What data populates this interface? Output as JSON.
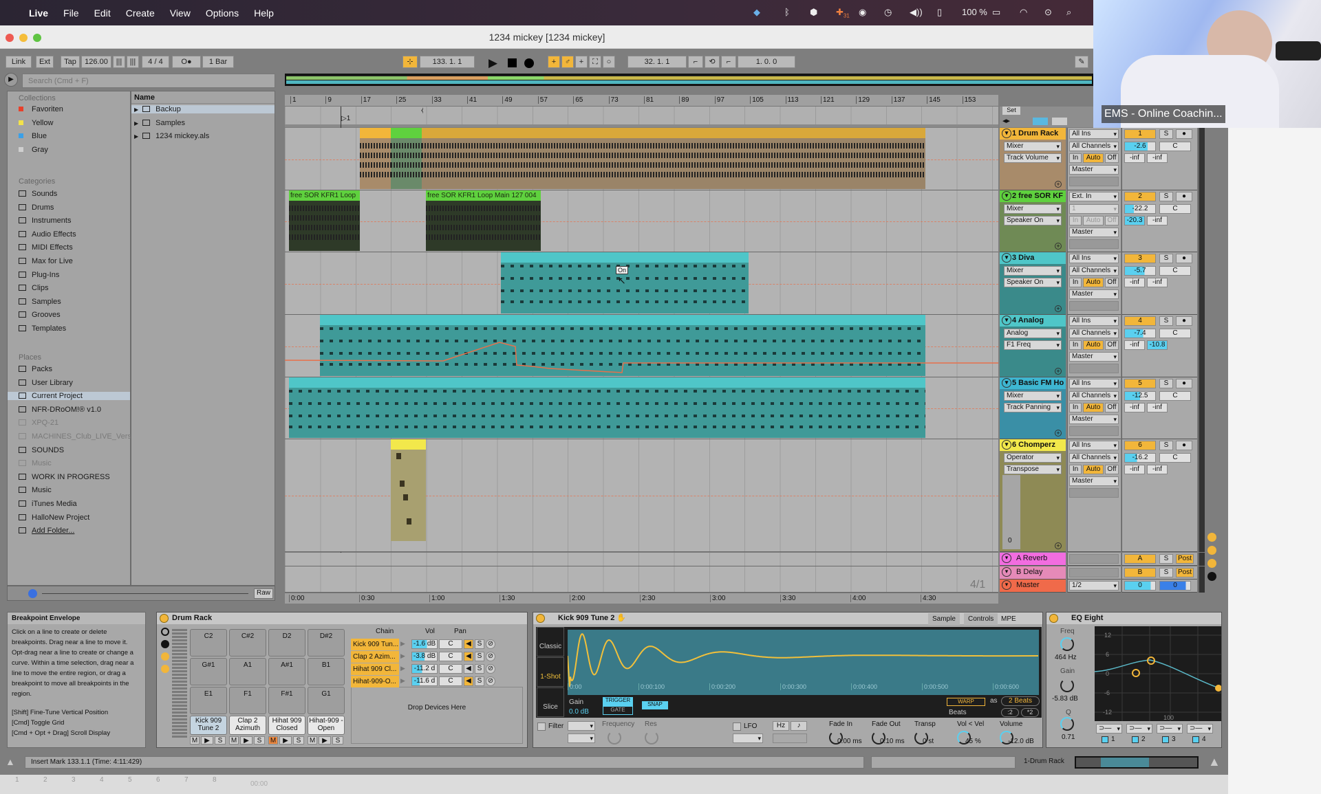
{
  "menubar": {
    "app": "Live",
    "items": [
      "File",
      "Edit",
      "Create",
      "View",
      "Options",
      "Help"
    ],
    "battery": "100 %",
    "calendar_badge": "31"
  },
  "window": {
    "title": "1234 mickey [1234 mickey]"
  },
  "webcam": {
    "label": "EMS - Online Coachin..."
  },
  "control_bar": {
    "link": "Link",
    "ext": "Ext",
    "tap": "Tap",
    "tempo": "126.00",
    "signature": "4 / 4",
    "metronome": "O●",
    "quantize": "1 Bar",
    "position": "133.  1.  1",
    "loop_start": "32.  1.  1",
    "loop_length": "1.  0.  0"
  },
  "browser": {
    "search_placeholder": "Search (Cmd + F)",
    "collections_header": "Collections",
    "collections": [
      {
        "label": "Favoriten",
        "color": "#e8402a"
      },
      {
        "label": "Yellow",
        "color": "#f2e24a"
      },
      {
        "label": "Blue",
        "color": "#3aa0e8"
      },
      {
        "label": "Gray",
        "color": "#cfcfcf"
      }
    ],
    "categories_header": "Categories",
    "categories": [
      "Sounds",
      "Drums",
      "Instruments",
      "Audio Effects",
      "MIDI Effects",
      "Max for Live",
      "Plug-Ins",
      "Clips",
      "Samples",
      "Grooves",
      "Templates"
    ],
    "places_header": "Places",
    "places": [
      {
        "label": "Packs"
      },
      {
        "label": "User Library"
      },
      {
        "label": "Current Project",
        "selected": true
      },
      {
        "label": "NFR-DRoOM!® v1.0"
      },
      {
        "label": "XPQ-21",
        "dim": true
      },
      {
        "label": "MACHINES_Club_LIVE_Versio",
        "dim": true
      },
      {
        "label": "SOUNDS"
      },
      {
        "label": "Music",
        "dim": true
      },
      {
        "label": "WORK IN PROGRESS"
      },
      {
        "label": "Music"
      },
      {
        "label": "iTunes Media"
      },
      {
        "label": "HalloNew Project"
      },
      {
        "label": "Add Folder..."
      }
    ],
    "name_header": "Name",
    "files": [
      {
        "label": "Backup",
        "selected": true
      },
      {
        "label": "Samples"
      },
      {
        "label": "1234 mickey.als"
      }
    ],
    "preview_raw": "Raw"
  },
  "arrangement": {
    "bar_ticks": [
      "1",
      "9",
      "17",
      "25",
      "33",
      "41",
      "49",
      "57",
      "65",
      "73",
      "81",
      "89",
      "97",
      "105",
      "113",
      "121",
      "129",
      "137",
      "145",
      "153"
    ],
    "time_ticks": [
      "0:00",
      "0:30",
      "1:00",
      "1:30",
      "2:00",
      "2:30",
      "3:00",
      "3:30",
      "4:00",
      "4:30"
    ],
    "locator": "1",
    "set_label": "Set",
    "zoom": "4/1",
    "tooltip": "On"
  },
  "tracks": [
    {
      "number": "1",
      "name": "1 Drum Rack",
      "color": "#f2b63a",
      "body": "#a88b6a",
      "device": "Mixer",
      "param": "Track Volume",
      "input": "All Ins",
      "channel": "All Channels",
      "output": "Master",
      "volume": "-2.6",
      "volume_level": 0.75,
      "pan": "C",
      "send_a": "-inf",
      "send_b": "-inf",
      "clips": [
        {
          "start": 17,
          "end": 24,
          "color": "#f2b63a",
          "body": "#a88b6a"
        },
        {
          "start": 24,
          "end": 31,
          "color": "#5fd13e",
          "body": "#6a8a6a"
        },
        {
          "start": 31,
          "end": 145,
          "color": "#d9a83a",
          "body": "#9a8468"
        }
      ]
    },
    {
      "number": "2",
      "name": "2 free SOR KF",
      "color": "#5fd13e",
      "body": "#6f8a55",
      "device": "Mixer",
      "param": "Speaker On",
      "input": "Ext. In",
      "channel": "1",
      "output": "Master",
      "volume": "-22.2",
      "volume_level": 0.3,
      "pan": "C",
      "send_a": "-20.3",
      "send_b": "-inf",
      "clips": [
        {
          "start": 1,
          "end": 17,
          "color": "#5fd13e",
          "body": "#2e3a28",
          "label": "free SOR KFR1 Loop"
        },
        {
          "start": 32,
          "end": 58,
          "color": "#5fd13e",
          "body": "#2e3a28",
          "label": "free SOR KFR1 Loop Main 127 004"
        }
      ]
    },
    {
      "number": "3",
      "name": "3 Diva",
      "color": "#4fc6c8",
      "body": "#3a8a8a",
      "device": "Mixer",
      "param": "Speaker On",
      "input": "All Ins",
      "channel": "All Channels",
      "output": "Master",
      "volume": "-5.7",
      "volume_level": 0.65,
      "pan": "C",
      "send_a": "-inf",
      "send_b": "-inf",
      "clips": [
        {
          "start": 49,
          "end": 105,
          "color": "#4fc6c8",
          "body": "#3f9a98"
        }
      ]
    },
    {
      "number": "4",
      "name": "4 Analog",
      "color": "#4fc6c8",
      "body": "#3a8a8a",
      "device": "Analog",
      "param": "F1 Freq",
      "input": "All Ins",
      "channel": "All Channels",
      "output": "Master",
      "volume": "-7.4",
      "volume_level": 0.6,
      "pan": "C",
      "send_a": "-inf",
      "send_b": "-10.8",
      "clips": [
        {
          "start": 8,
          "end": 145,
          "color": "#4fc6c8",
          "body": "#3f9a98"
        }
      ]
    },
    {
      "number": "5",
      "name": "5 Basic FM Ho",
      "color": "#3eb6d1",
      "body": "#3a8fa6",
      "device": "Mixer",
      "param": "Track Panning",
      "input": "All Ins",
      "channel": "All Channels",
      "output": "Master",
      "volume": "-12.5",
      "volume_level": 0.5,
      "pan": "C",
      "send_a": "-inf",
      "send_b": "-inf",
      "clips": [
        {
          "start": 1,
          "end": 145,
          "color": "#4fc6c8",
          "body": "#3f9a98"
        }
      ]
    },
    {
      "number": "6",
      "name": "6 Chomperz",
      "color": "#f2e84b",
      "body": "#8e8a55",
      "device": "Operator",
      "param": "Transpose",
      "input": "All Ins",
      "channel": "All Channels",
      "output": "Master",
      "volume": "-16.2",
      "volume_level": 0.4,
      "pan": "C",
      "send_a": "-inf",
      "send_b": "-inf",
      "lane_value": "0",
      "clips": [
        {
          "start": 24,
          "end": 32,
          "color": "#f2e84b",
          "body": "#a8a070"
        }
      ]
    }
  ],
  "returns": [
    {
      "name": "A Reverb",
      "color": "#f26de0",
      "letter": "A",
      "solo": "S",
      "post": "Post"
    },
    {
      "name": "B Delay",
      "color": "#e58ab8",
      "letter": "B",
      "solo": "S",
      "post": "Post"
    }
  ],
  "master": {
    "name": "Master",
    "color": "#f06a4a",
    "output": "1/2",
    "volume": "0",
    "pan": "0"
  },
  "mixer_labels": {
    "solo": "S",
    "in": "In",
    "auto": "Auto",
    "off": "Off"
  },
  "info": {
    "title": "Breakpoint Envelope",
    "body": "Click on a line to create or delete breakpoints. Drag near a line to move it. Opt-drag near a line to create or change a curve. Within a time selection, drag near a line to move the entire region, or drag a breakpoint to move all breakpoints in the region.",
    "shortcuts": [
      "[Shift] Fine-Tune Vertical Position",
      "[Cmd] Toggle Grid",
      "[Cmd + Opt + Drag] Scroll Display"
    ]
  },
  "drum_rack": {
    "title": "Drum Rack",
    "pads": [
      "C2",
      "C#2",
      "D2",
      "D#2",
      "G#1",
      "A1",
      "A#1",
      "B1",
      "E1",
      "F1",
      "F#1",
      "G1"
    ],
    "named_pads": [
      {
        "label": "Kick 909 Tune 2",
        "muted": false
      },
      {
        "label": "Clap 2 Azimuth",
        "muted": false
      },
      {
        "label": "Hihat 909 Closed",
        "muted": true
      },
      {
        "label": "Hihat-909 -Open",
        "muted": false
      }
    ],
    "pad_buttons": [
      "M",
      "S"
    ],
    "chain_header": "Chain",
    "vol_header": "Vol",
    "pan_header": "Pan",
    "chains": [
      {
        "name": "Kick 909 Tun...",
        "vol": "-1.6 dB",
        "pan": "C"
      },
      {
        "name": "Clap 2 Azim...",
        "vol": "-3.8 dB",
        "pan": "C"
      },
      {
        "name": "Hihat 909 Cl...",
        "vol": "-11.2 d",
        "pan": "C"
      },
      {
        "name": "Hihat-909-O...",
        "vol": "-11.6 d",
        "pan": "C"
      }
    ],
    "drop": "Drop Devices Here"
  },
  "simpler": {
    "title": "Kick 909 Tune 2",
    "tabs": [
      "Sample",
      "Controls",
      "MPE"
    ],
    "modes": [
      "Classic",
      "1-Shot",
      "Slice"
    ],
    "active_mode": "1-Shot",
    "time_labels": [
      "0:00",
      "0:00:100",
      "0:00:200",
      "0:00:300",
      "0:00:400",
      "0:00:500",
      "0:00:600"
    ],
    "gain_label": "Gain",
    "gain": "0.0 dB",
    "trigger": "TRIGGER",
    "gate": "GATE",
    "snap": "SNAP",
    "warp": "WARP",
    "as": "as",
    "beats": "2 Beats",
    "warp_mode": "Beats",
    "half": ":2",
    "double": "*2",
    "filter": "Filter",
    "frequency": "Frequency",
    "res": "Res",
    "lfo": "LFO",
    "hz": "Hz",
    "note": "♪",
    "params": [
      {
        "label": "Fade In",
        "value": "0.00 ms"
      },
      {
        "label": "Fade Out",
        "value": "0.10 ms"
      },
      {
        "label": "Transp",
        "value": "0 st"
      },
      {
        "label": "Vol < Vel",
        "value": "45 %"
      },
      {
        "label": "Volume",
        "value": "-12.0 dB"
      }
    ]
  },
  "eq": {
    "title": "EQ Eight",
    "freq_label": "Freq",
    "freq": "464 Hz",
    "gain_label": "Gain",
    "gain": "-5.83 dB",
    "q_label": "Q",
    "q": "0.71",
    "y_ticks": [
      "12",
      "6",
      "0",
      "-6",
      "-12"
    ],
    "x_tick": "100",
    "bands": [
      "1",
      "2",
      "3",
      "4"
    ]
  },
  "status": {
    "text": "Insert Mark 133.1.1 (Time: 4:11:429)",
    "device": "1-Drum Rack"
  },
  "bottom_strip": {
    "numbers": [
      "1",
      "2",
      "3",
      "4",
      "5",
      "6",
      "7",
      "8"
    ],
    "time": "00:00"
  }
}
